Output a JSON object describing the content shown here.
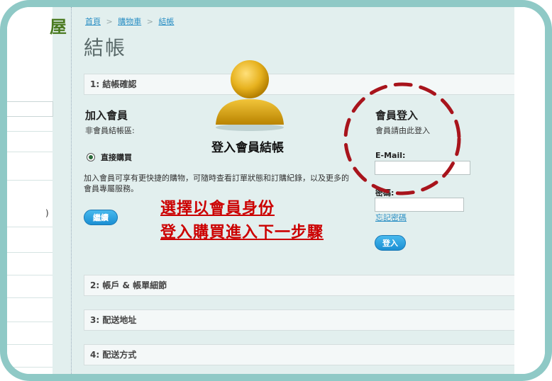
{
  "brand": {
    "logo_char": "屋"
  },
  "breadcrumb": {
    "items": [
      "首頁",
      "購物車",
      "結帳"
    ],
    "separator": ">"
  },
  "page": {
    "title": "結帳"
  },
  "sections": [
    {
      "label": "1: 結帳確認"
    },
    {
      "label": "2: 帳戶 & 帳單細節"
    },
    {
      "label": "3: 配送地址"
    },
    {
      "label": "4: 配送方式"
    }
  ],
  "join": {
    "heading": "加入會員",
    "subheading": "非會員結帳區:",
    "radio_label": "直接購買",
    "description": "加入會員可享有更快捷的購物，可隨時查看訂單狀態和訂購紀錄，以及更多的會員專屬服務。",
    "continue_label": "繼續"
  },
  "callout": {
    "avatar_caption": "登入會員結帳",
    "annotation_line1": "選擇以會員身份",
    "annotation_line2": "登入購買進入下一步驟"
  },
  "login": {
    "heading": "會員登入",
    "subheading": "會員請由此登入",
    "email_label": "E-Mail:",
    "email_value": "",
    "password_label": "密碼:",
    "password_value": "",
    "forgot_label": "忘記密碼",
    "login_label": "登入"
  },
  "left_fragment": {
    "paren": ")"
  },
  "colors": {
    "frame": "#8fc9c6",
    "page_bg": "#e2efee",
    "button": "#1a8fd3",
    "annotation": "#cc0000",
    "link": "#2b8fc4"
  }
}
